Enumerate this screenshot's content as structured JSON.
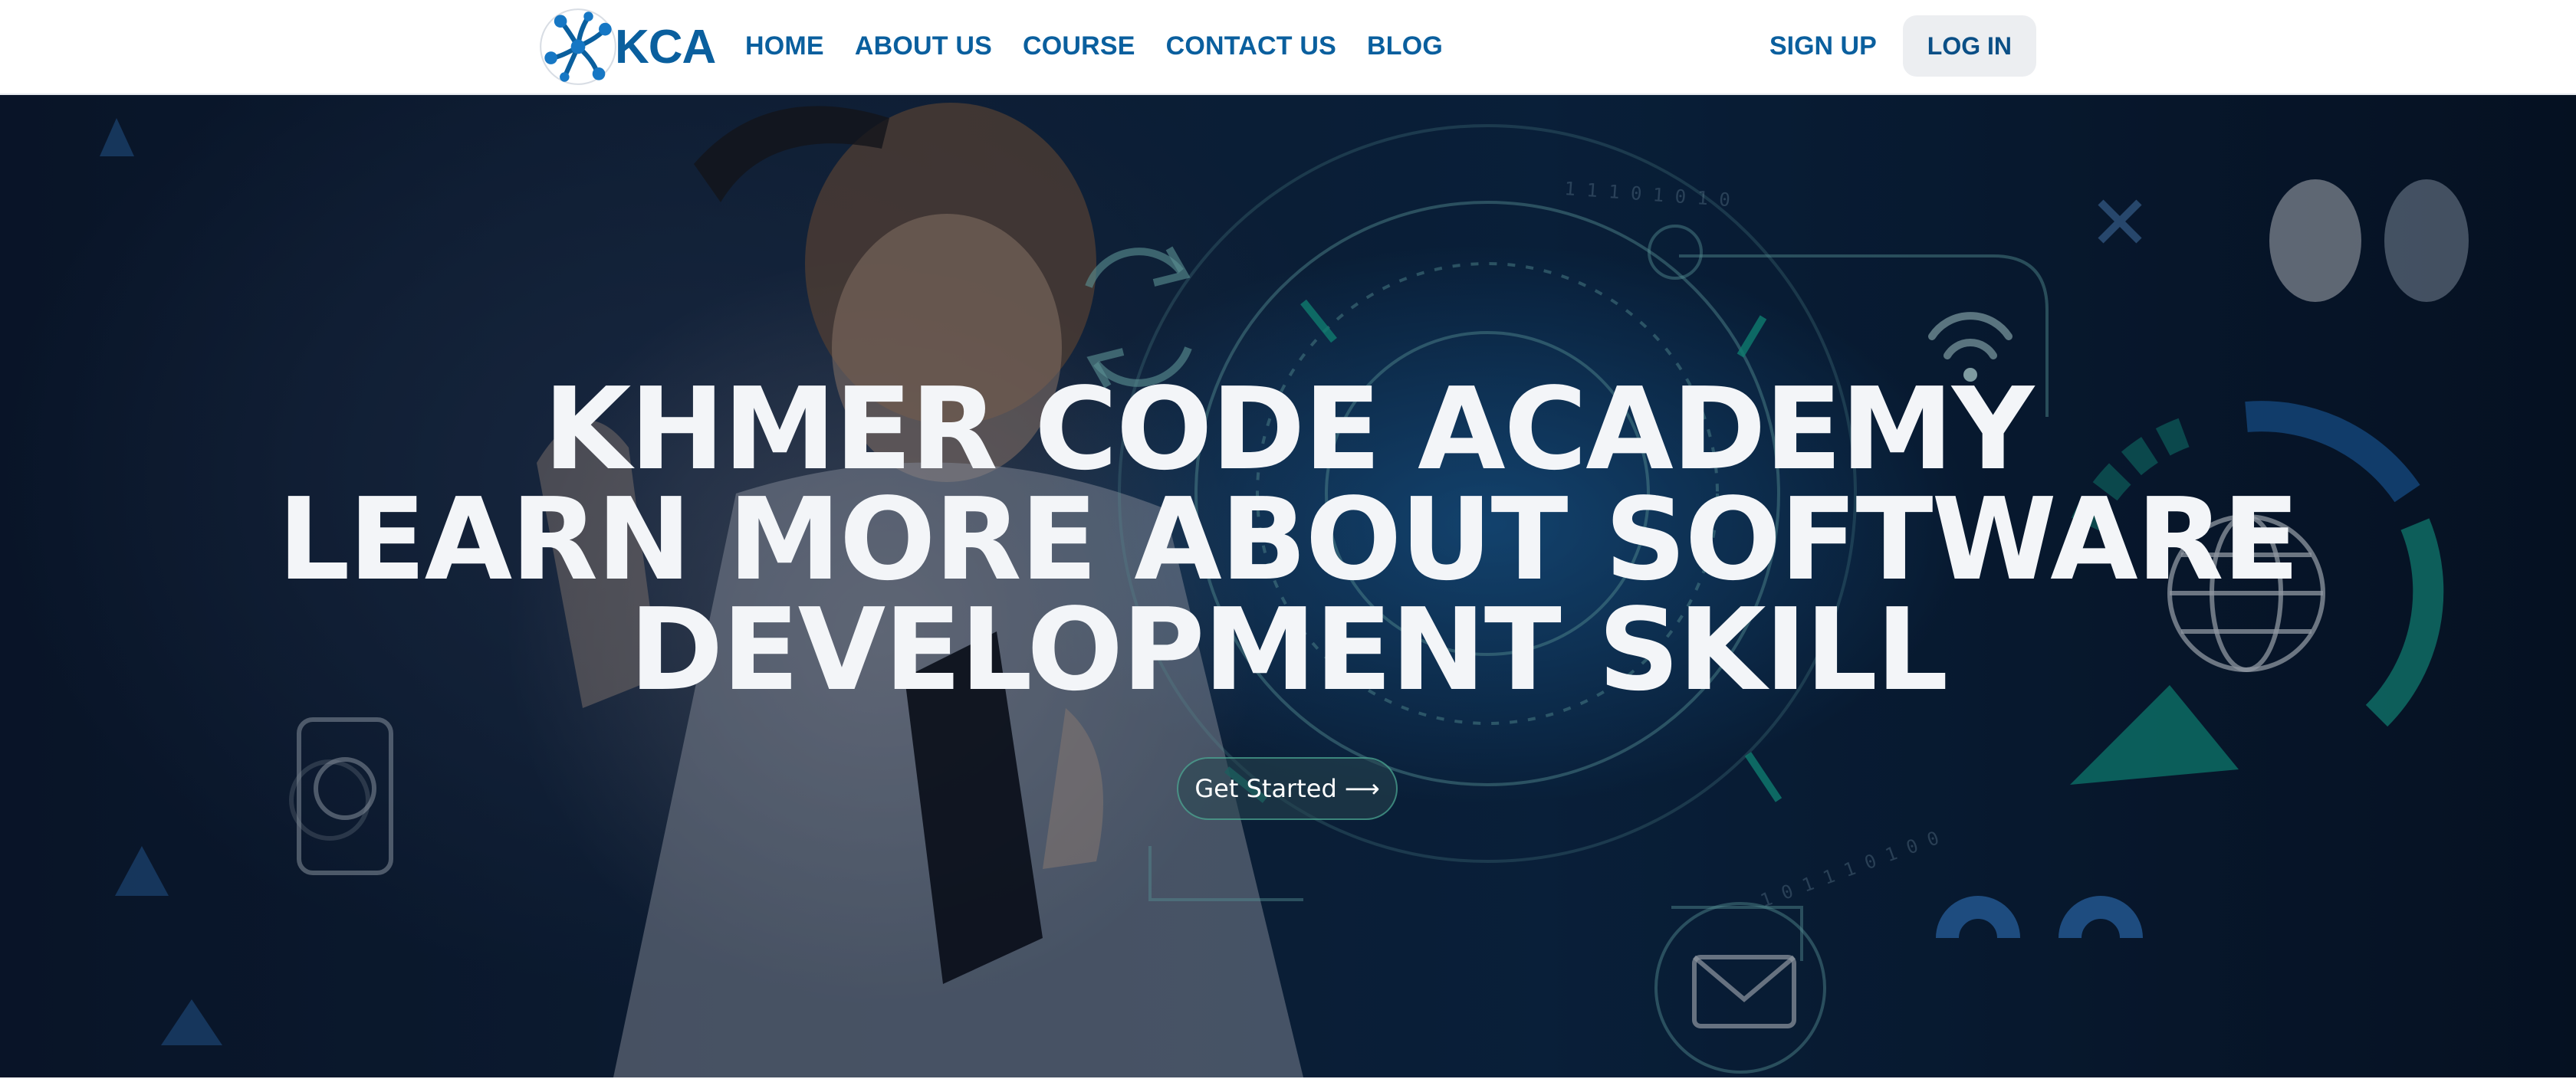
{
  "brand": {
    "name": "KCA",
    "logo_icon": "molecule-logo-icon",
    "color": "#0a5f9e"
  },
  "nav": {
    "links": [
      {
        "label": "HOME"
      },
      {
        "label": "ABOUT US"
      },
      {
        "label": "COURSE"
      },
      {
        "label": "CONTACT US"
      },
      {
        "label": "BLOG"
      }
    ],
    "signup_label": "SIGN UP",
    "login_label": "LOG IN"
  },
  "hero": {
    "headline_lines": [
      "KHMER CODE ACADEMY",
      "LEARN MORE ABOUT SOFTWARE",
      "DEVELOPMENT SKILL"
    ],
    "cta_label": "Get Started",
    "cta_icon": "arrow-right-icon",
    "background_icons": [
      "refresh-icon",
      "wifi-icon",
      "globe-icon",
      "mail-icon",
      "phone-user-icon",
      "lightbulb-icon",
      "close-icon"
    ],
    "accent_color": "#1aa89a"
  }
}
